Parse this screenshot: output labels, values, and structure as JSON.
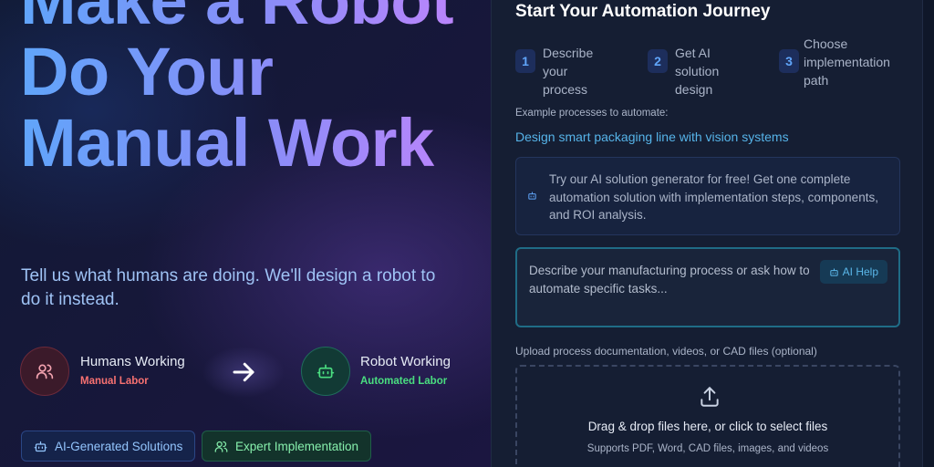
{
  "hero": {
    "title": "Make a Robot Do Your Manual Work",
    "subtitle": "Tell us what humans are doing. We'll design a robot to do it instead."
  },
  "transformation": {
    "from": {
      "title": "Humans Working",
      "subtitle": "Manual Labor",
      "icon": "users-icon",
      "color": "#f87171"
    },
    "to": {
      "title": "Robot Working",
      "subtitle": "Automated Labor",
      "icon": "robot-icon",
      "color": "#4ade80"
    },
    "arrow_icon": "arrow-right-icon"
  },
  "badges": [
    {
      "label": "AI-Generated Solutions",
      "icon": "robot-icon"
    },
    {
      "label": "Expert Implementation",
      "icon": "users-icon"
    }
  ],
  "panel": {
    "title": "Start Your Automation Journey",
    "steps": [
      {
        "number": "1",
        "line1": "Describe your",
        "line2": "process",
        "line3": ""
      },
      {
        "number": "2",
        "line1": "Get AI solution",
        "line2": "design",
        "line3": ""
      },
      {
        "number": "3",
        "line1": "Choose",
        "line2": "implementation",
        "line3": "path"
      }
    ],
    "examples_label": "Example processes to automate:",
    "example_link": "Design smart packaging line with vision systems",
    "promo_text": "Try our AI solution generator for free! Get one complete automation solution with implementation steps, components, and ROI analysis.",
    "input": {
      "placeholder": "Describe your manufacturing process or ask how to automate specific tasks...",
      "ai_help_label": "AI Help"
    },
    "upload": {
      "label": "Upload process documentation, videos, or CAD files (optional)",
      "main_text": "Drag & drop files here, or click to select files",
      "sub_text": "Supports PDF, Word, CAD files, images, and videos",
      "icon": "upload-icon"
    }
  },
  "colors": {
    "accent_blue": "#60a5fa",
    "accent_purple": "#c084fc",
    "link": "#56b4e9",
    "red_label": "#f87171",
    "green_label": "#4ade80"
  }
}
